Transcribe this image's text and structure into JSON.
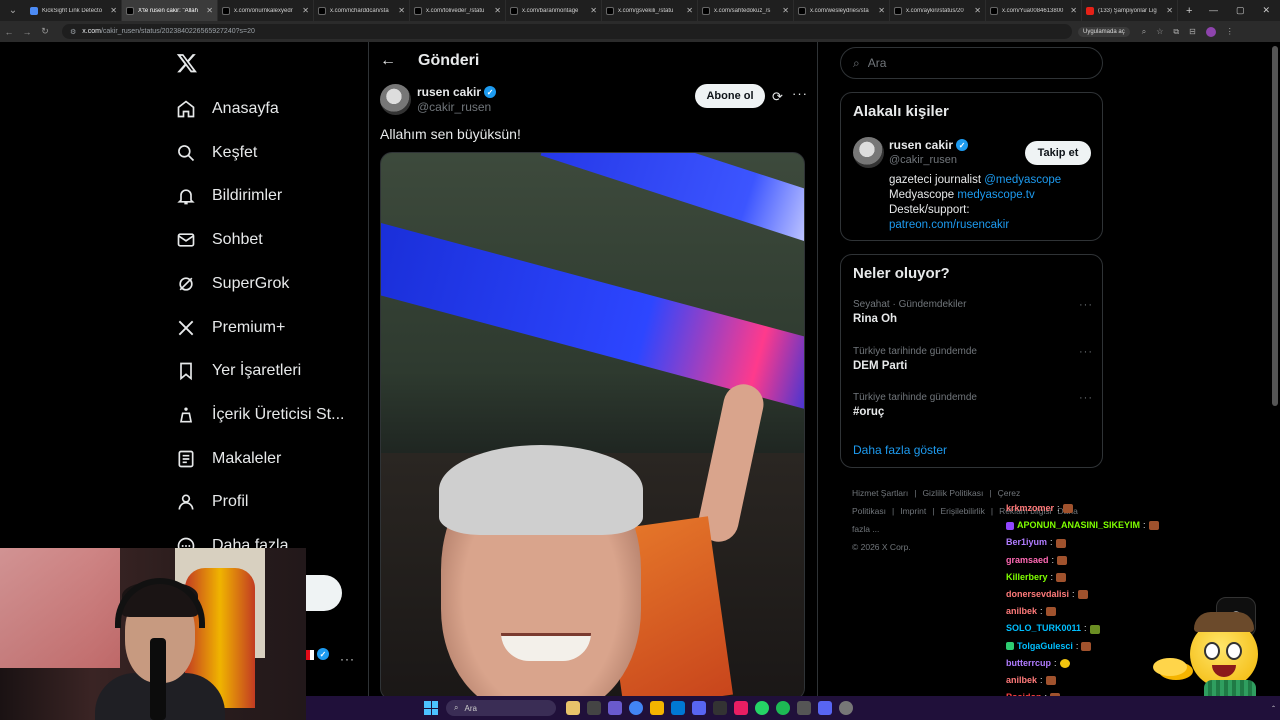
{
  "browser": {
    "tabs": [
      {
        "label": "KickSight Link Detecto",
        "icon": "kicksight-icon",
        "active": false
      },
      {
        "label": "X'te rusen cakir: \"Allah",
        "icon": "x-icon",
        "active": true
      },
      {
        "label": "x.com/onurnkalexyedr",
        "icon": "x-icon",
        "active": false
      },
      {
        "label": "x.com/richarddcan/sta",
        "icon": "x-icon",
        "active": false
      },
      {
        "label": "x.com/toliveder_/statu",
        "icon": "x-icon",
        "active": false
      },
      {
        "label": "x.com/baranmontage",
        "icon": "x-icon",
        "active": false
      },
      {
        "label": "x.com/gsvekili_/statu",
        "icon": "x-icon",
        "active": false
      },
      {
        "label": "x.com/sahtedokuz_/s",
        "icon": "x-icon",
        "active": false
      },
      {
        "label": "x.com/wesleydries/sta",
        "icon": "x-icon",
        "active": false
      },
      {
        "label": "x.com/aykiri/status/20",
        "icon": "x-icon",
        "active": false
      },
      {
        "label": "x.com/Yua0084613800",
        "icon": "x-icon",
        "active": false
      },
      {
        "label": "(133) Şampiyonlar Lig",
        "icon": "youtube-icon",
        "active": false
      }
    ],
    "url_domain": "x.com",
    "url_path": "/cakir_rusen/status/2023840226565927240?s=20",
    "open_in_app": "Uygulamada aç"
  },
  "nav": {
    "items": [
      {
        "label": "Anasayfa",
        "icon": "home-icon"
      },
      {
        "label": "Keşfet",
        "icon": "search-icon"
      },
      {
        "label": "Bildirimler",
        "icon": "bell-icon"
      },
      {
        "label": "Sohbet",
        "icon": "mail-icon"
      },
      {
        "label": "SuperGrok",
        "icon": "grok-icon"
      },
      {
        "label": "Premium+",
        "icon": "x-premium-icon"
      },
      {
        "label": "Yer İşaretleri",
        "icon": "bookmark-icon"
      },
      {
        "label": "İçerik Üreticisi St...",
        "icon": "creator-studio-icon"
      },
      {
        "label": "Makaleler",
        "icon": "article-icon"
      },
      {
        "label": "Profil",
        "icon": "profile-icon"
      },
      {
        "label": "Daha fazla",
        "icon": "more-circle-icon"
      }
    ]
  },
  "post": {
    "header_title": "Gönderi",
    "author_name": "rusen cakir",
    "author_handle": "@cakir_rusen",
    "subscribe_label": "Abone ol",
    "text": "Allahım sen büyüksün!",
    "media_description_icon": "video-media"
  },
  "sidebar": {
    "search_placeholder": "Ara",
    "related_title": "Alakalı kişiler",
    "related_person": {
      "name": "rusen cakir",
      "handle": "@cakir_rusen",
      "follow_label": "Takip et",
      "bio_line1_text": "gazeteci journalist ",
      "bio_line1_link": "@medyascope",
      "bio_line2_text": "Medyascope ",
      "bio_line2_link": "medyascope.tv",
      "bio_line3_text": "Destek/support:",
      "bio_line4_link": "patreon.com/rusencakir"
    },
    "trends_title": "Neler oluyor?",
    "trends": [
      {
        "category": "Seyahat · Gündemdekiler",
        "name": "Rina Oh"
      },
      {
        "category": "Türkiye tarihinde gündemde",
        "name": "DEM Parti"
      },
      {
        "category": "Türkiye tarihinde gündemde",
        "name": "#oruç"
      }
    ],
    "show_more": "Daha fazla göster",
    "footer_links": [
      "Hizmet Şartları",
      "|",
      "Gizlilik Politikası",
      "|",
      "Çerez Politikası",
      "|",
      "Imprint",
      "|",
      "Erişilebilirlik",
      "|",
      "Reklam bilgisi",
      "Daha fazla ..."
    ],
    "copyright": "© 2026 X Corp."
  },
  "chat": {
    "messages": [
      {
        "user": "krkmzomer",
        "color": "#ff7a7a",
        "badge": "",
        "emote": "brown"
      },
      {
        "user": "APONUN_ANASINI_SIKEYIM",
        "color": "#7fff00",
        "badge": "purple",
        "emote": "gray"
      },
      {
        "user": "Ber1iyum",
        "color": "#b07cff",
        "badge": "",
        "emote": "brown"
      },
      {
        "user": "gramsaed",
        "color": "#ff69b4",
        "badge": "",
        "emote": "brown"
      },
      {
        "user": "Killerbery",
        "color": "#7fff00",
        "badge": "",
        "emote": "brown"
      },
      {
        "user": "donersevdalisi",
        "color": "#ff7a7a",
        "badge": "",
        "emote": "brown"
      },
      {
        "user": "anilbek",
        "color": "#ff7a7a",
        "badge": "",
        "emote": "brown"
      },
      {
        "user": "SOLO_TURK0011",
        "color": "#00bfff",
        "badge": "",
        "emote": "green"
      },
      {
        "user": "TolgaGulesci",
        "color": "#00bfff",
        "badge": "green",
        "emote": "brown"
      },
      {
        "user": "butterrcup",
        "color": "#b07cff",
        "badge": "",
        "emote": "yellow"
      },
      {
        "user": "anilbek",
        "color": "#ff7a7a",
        "badge": "",
        "emote": "brown"
      },
      {
        "user": "Posidon",
        "color": "#ff4040",
        "badge": "",
        "emote": "brown"
      }
    ]
  },
  "taskbar": {
    "search_label": "Ara"
  }
}
